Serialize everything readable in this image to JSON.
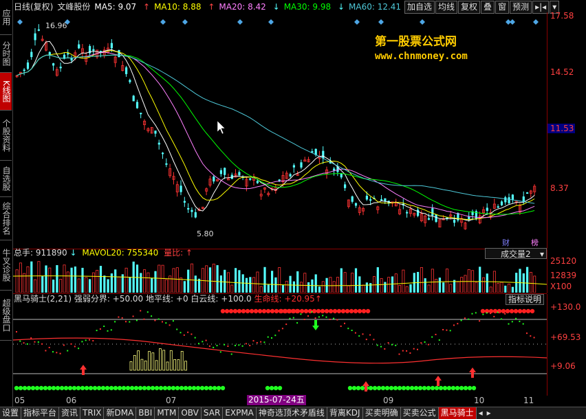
{
  "nav": {
    "items": [
      {
        "label": "应用"
      },
      {
        "label": "分时图"
      },
      {
        "label": "K线图",
        "active": true
      },
      {
        "label": "个股资料"
      },
      {
        "label": "自选股"
      },
      {
        "label": "综合排名"
      },
      {
        "label": "牛叉诊股"
      },
      {
        "label": "超级盘口"
      }
    ]
  },
  "header": {
    "chart_mode": "日线(复权)",
    "stock_name": "文峰股份",
    "ma5": "MA5: 9.07",
    "ma10": "MA10: 8.88",
    "ma20": "MA20: 8.42",
    "ma30": "MA30: 9.98",
    "ma60": "MA60: 12.41",
    "ma5_arrow": "↑",
    "ma10_arrow": "↑",
    "ma20_arrow": "↓",
    "ma30_arrow": "↓",
    "ma60_arrow": "↓"
  },
  "toolbar": {
    "add_watch": "加自选",
    "ma_line": "均线",
    "adjust": "复权",
    "overlay": "叠",
    "window": "窗",
    "forecast": "预测",
    "more": "▸|◂"
  },
  "watermark": {
    "title": "第一股票公式网",
    "url": "www.chnmoney.com"
  },
  "main_chart": {
    "price_high_label": "16.96",
    "price_low_label": "5.80",
    "axis_labels": [
      "17.58",
      "14.52",
      "11.53",
      "8.37"
    ],
    "current_price_tag": "11.53",
    "badges": {
      "cai": "财",
      "bang": "榜"
    }
  },
  "volume": {
    "header_total": "总手: 911890",
    "header_arrow": "↓",
    "mavol20": "MAVOL20: 755340",
    "ratio_label": "量比: ↑",
    "select_label": "成交量2",
    "axis_labels": [
      "25120",
      "12839",
      "X100"
    ]
  },
  "indicator": {
    "name": "黑马骑士(2,21)",
    "strong_weak": "强弱分界: +50.00",
    "ground": "地平线: +0",
    "white_cloud": "白云线: +100.0",
    "life": "生命线: +20.95",
    "life_arrow": "↑",
    "desc_button": "指标说明",
    "axis_labels": [
      "+130.0",
      "+69.53",
      "+9.06"
    ]
  },
  "date_axis": {
    "labels": [
      "05",
      "06",
      "07",
      "09",
      "10",
      "11"
    ],
    "cursor_date": "2015-07-24五"
  },
  "bottom_tabs": [
    {
      "label": "设置"
    },
    {
      "label": "指标平台"
    },
    {
      "label": "资讯"
    },
    {
      "label": "TRIX"
    },
    {
      "label": "新DMA"
    },
    {
      "label": "BBI"
    },
    {
      "label": "MTM"
    },
    {
      "label": "OBV"
    },
    {
      "label": "SAR"
    },
    {
      "label": "EXPMA"
    },
    {
      "label": "神奇选顶术矛盾线"
    },
    {
      "label": "背离KDJ"
    },
    {
      "label": "买卖明确"
    },
    {
      "label": "买卖公式"
    },
    {
      "label": "黑马骑士",
      "active": true
    }
  ],
  "colors": {
    "up": "#ff3333",
    "down": "#54ffff",
    "ma5": "#ffffff",
    "ma10": "#ffff00",
    "ma20": "#ff80ff",
    "ma30": "#00ff00",
    "ma60": "#4ec9d9",
    "axis": "#8b0000",
    "accent": "#c00000"
  }
}
